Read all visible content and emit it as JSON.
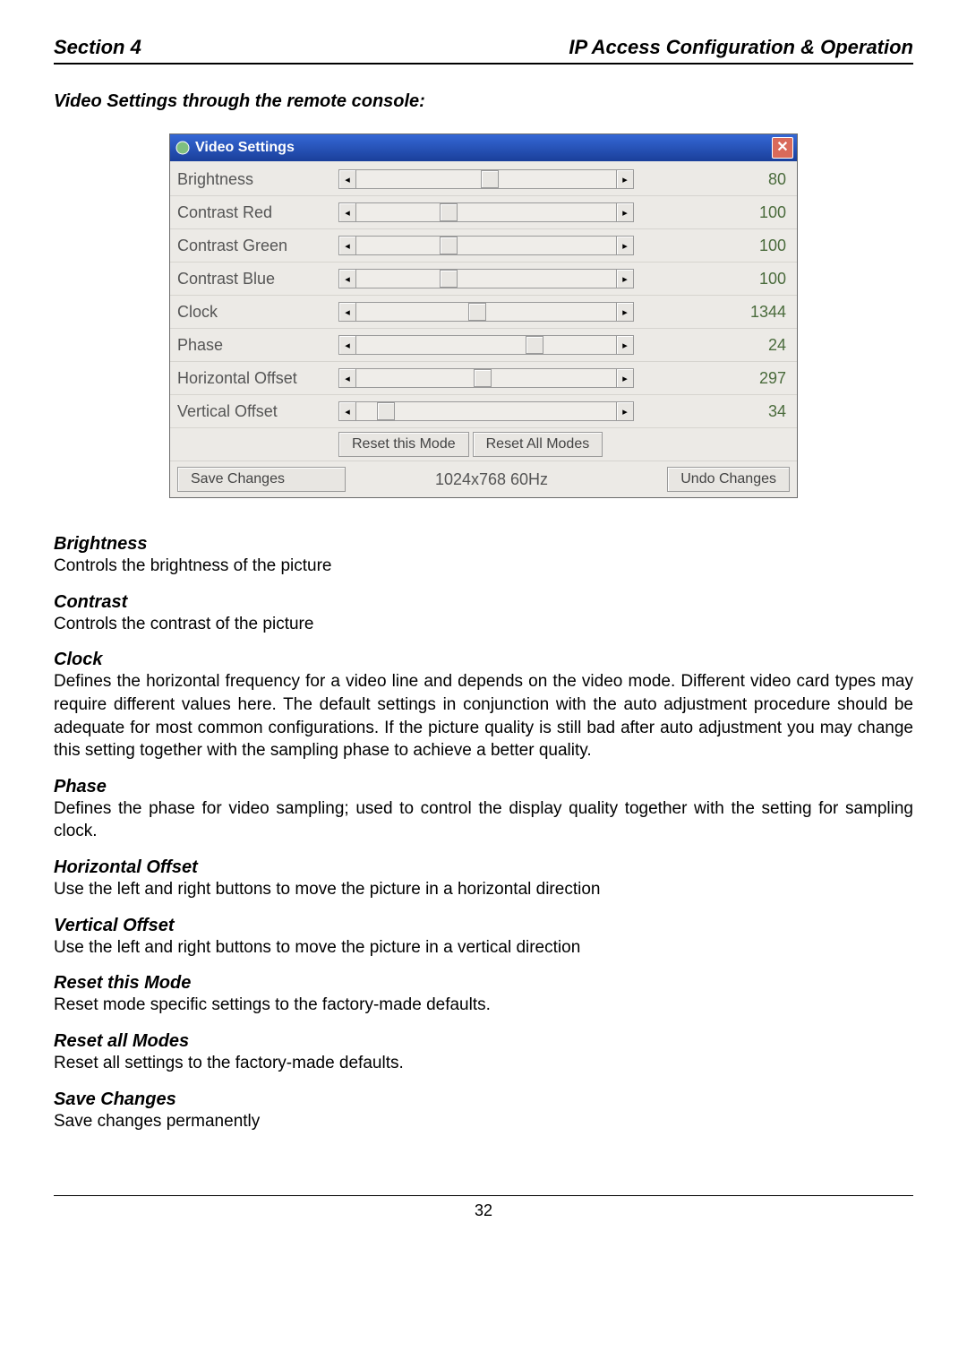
{
  "header": {
    "left": "Section 4",
    "right": "IP Access Configuration & Operation"
  },
  "caption": "Video Settings through the remote console:",
  "dialog": {
    "title": "Video Settings",
    "sliders": [
      {
        "label": "Brightness",
        "value": "80",
        "thumb_pct": 48
      },
      {
        "label": "Contrast Red",
        "value": "100",
        "thumb_pct": 32
      },
      {
        "label": "Contrast Green",
        "value": "100",
        "thumb_pct": 32
      },
      {
        "label": "Contrast Blue",
        "value": "100",
        "thumb_pct": 32
      },
      {
        "label": "Clock",
        "value": "1344",
        "thumb_pct": 43
      },
      {
        "label": "Phase",
        "value": "24",
        "thumb_pct": 65
      },
      {
        "label": "Horizontal Offset",
        "value": "297",
        "thumb_pct": 45
      },
      {
        "label": "Vertical Offset",
        "value": "34",
        "thumb_pct": 8
      }
    ],
    "reset_this": "Reset this Mode",
    "reset_all": "Reset All Modes",
    "save": "Save Changes",
    "resolution": "1024x768 60Hz",
    "undo": "Undo Changes"
  },
  "definitions": [
    {
      "term": "Brightness",
      "text": "Controls the brightness of the picture"
    },
    {
      "term": "Contrast",
      "text": "Controls the contrast of the picture"
    },
    {
      "term": "Clock",
      "text": "Defines the horizontal frequency for a video line and depends on the video mode. Different video card types may require different values here. The default settings in conjunction with the auto adjustment procedure should be adequate for most common configurations. If the picture quality is still bad after auto adjustment you may change this setting together with the sampling phase to achieve a better quality.",
      "justify": true
    },
    {
      "term": "Phase",
      "text": "Defines the phase for video sampling; used to control the display quality together with the setting for sampling clock.",
      "justify": true
    },
    {
      "term": "Horizontal Offset",
      "text": "Use the left and right buttons to move the picture in a horizontal direction"
    },
    {
      "term": "Vertical Offset",
      "text": "Use the left and right buttons to move the picture in a vertical direction"
    },
    {
      "term": "Reset this Mode",
      "text": "Reset mode specific settings to the factory-made defaults."
    },
    {
      "term": "Reset all Modes",
      "text": "Reset all settings to the factory-made defaults."
    },
    {
      "term": "Save Changes",
      "text": "Save changes permanently"
    }
  ],
  "page_number": "32"
}
